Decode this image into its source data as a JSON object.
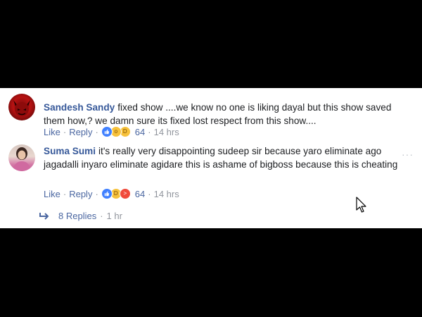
{
  "comments": [
    {
      "author": "Sandesh Sandy",
      "text": "fixed show ....we know no one is liking dayal but this show saved them how,? we damn sure its fixed lost respect from this show....",
      "actions": {
        "like": "Like",
        "reply": "Reply"
      },
      "reaction_count": "64",
      "time": "14 hrs",
      "reactions": [
        "like-icon",
        "wow-icon",
        "haha-icon"
      ]
    },
    {
      "author": "Suma Sumi",
      "text": "it's really very disappointing sudeep sir because yaro eliminate ago jagadalli inyaro eliminate agidare this is ashame of bigboss because this is cheating",
      "actions": {
        "like": "Like",
        "reply": "Reply"
      },
      "reaction_count": "64",
      "time": "14 hrs",
      "reactions": [
        "like-icon",
        "haha-icon",
        "angry-icon"
      ]
    }
  ],
  "replies": {
    "label": "8 Replies",
    "time": "1 hr"
  },
  "menu": {
    "more": "···"
  },
  "colors": {
    "background": "#000000",
    "panel": "#ffffff",
    "author": "#365899",
    "link": "#4b67a1",
    "muted": "#90949c",
    "like": "#4080ff",
    "angry": "#f04a3b",
    "yellow": "#f7c23c"
  }
}
